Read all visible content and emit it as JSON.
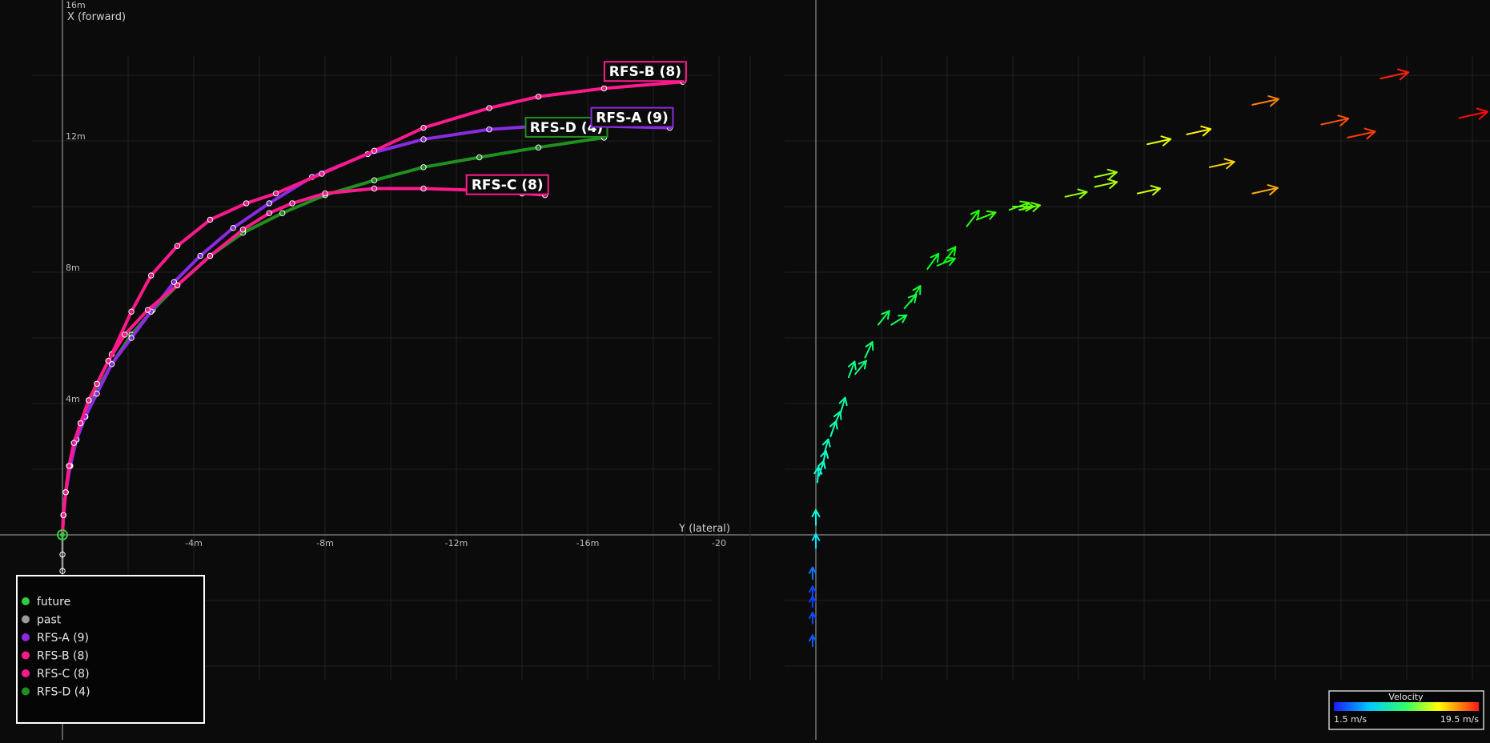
{
  "chart_data": [
    {
      "type": "line",
      "title": "",
      "xlabel": "Y (lateral)",
      "ylabel": "X (forward)",
      "x_ticks": [
        {
          "v": -4,
          "label": "-4m"
        },
        {
          "v": -8,
          "label": "-8m"
        },
        {
          "v": -12,
          "label": "-12m"
        },
        {
          "v": -16,
          "label": "-16m"
        },
        {
          "v": -20,
          "label": "-20"
        }
      ],
      "y_ticks": [
        {
          "v": 4,
          "label": "4m"
        },
        {
          "v": 8,
          "label": "8m"
        },
        {
          "v": 12,
          "label": "12m"
        },
        {
          "v": 16,
          "label": "16m"
        }
      ],
      "xlim": [
        0,
        -20.5
      ],
      "ylim": [
        0,
        16
      ],
      "grid": true,
      "legend_position": "bottom-left",
      "legend": [
        {
          "label": "future",
          "color": "#2ecc40"
        },
        {
          "label": "past",
          "color": "#9a9a9a"
        },
        {
          "label": "RFS-A (9)",
          "color": "#8a2be2"
        },
        {
          "label": "RFS-B (8)",
          "color": "#ff1a8c"
        },
        {
          "label": "RFS-C (8)",
          "color": "#ff1a8c"
        },
        {
          "label": "RFS-D (4)",
          "color": "#1f8f1f"
        }
      ],
      "series": [
        {
          "name": "past",
          "color": "#9a9a9a",
          "points": [
            [
              0,
              0
            ],
            [
              0,
              -0.6
            ],
            [
              0,
              -1.1
            ]
          ]
        },
        {
          "name": "RFS-D (4)",
          "color": "#1f8f1f",
          "label": "RFS-D (4)",
          "points": [
            [
              0,
              0
            ],
            [
              -0.03,
              0.6
            ],
            [
              -0.1,
              1.3
            ],
            [
              -0.23,
              2.1
            ],
            [
              -0.42,
              2.9
            ],
            [
              -0.68,
              3.6
            ],
            [
              -1.0,
              4.3
            ],
            [
              -1.5,
              5.2
            ],
            [
              -2.1,
              6.1
            ],
            [
              -2.75,
              6.85
            ],
            [
              -3.5,
              7.6
            ],
            [
              -4.5,
              8.5
            ],
            [
              -5.5,
              9.2
            ],
            [
              -6.7,
              9.8
            ],
            [
              -8.0,
              10.35
            ],
            [
              -9.5,
              10.8
            ],
            [
              -11.0,
              11.2
            ],
            [
              -12.7,
              11.5
            ],
            [
              -14.5,
              11.8
            ],
            [
              -16.5,
              12.1
            ]
          ]
        },
        {
          "name": "RFS-A (9)",
          "color": "#8a2be2",
          "label": "RFS-A (9)",
          "points": [
            [
              0,
              0
            ],
            [
              -0.03,
              0.6
            ],
            [
              -0.1,
              1.3
            ],
            [
              -0.24,
              2.1
            ],
            [
              -0.43,
              2.9
            ],
            [
              -0.7,
              3.6
            ],
            [
              -1.05,
              4.3
            ],
            [
              -1.5,
              5.2
            ],
            [
              -2.1,
              6.0
            ],
            [
              -2.7,
              6.8
            ],
            [
              -3.4,
              7.7
            ],
            [
              -4.2,
              8.5
            ],
            [
              -5.2,
              9.35
            ],
            [
              -6.3,
              10.1
            ],
            [
              -7.6,
              10.9
            ],
            [
              -9.3,
              11.6
            ],
            [
              -11.0,
              12.05
            ],
            [
              -13.0,
              12.35
            ],
            [
              -14.5,
              12.45
            ],
            [
              -16.5,
              12.45
            ],
            [
              -18.5,
              12.4
            ]
          ]
        },
        {
          "name": "RFS-B (8)",
          "color": "#ff1a8c",
          "label": "RFS-B (8)",
          "points": [
            [
              0,
              0
            ],
            [
              -0.03,
              0.6
            ],
            [
              -0.1,
              1.3
            ],
            [
              -0.2,
              2.1
            ],
            [
              -0.35,
              2.8
            ],
            [
              -0.55,
              3.4
            ],
            [
              -0.8,
              4.1
            ],
            [
              -1.05,
              4.6
            ],
            [
              -1.4,
              5.3
            ],
            [
              -1.5,
              5.5
            ],
            [
              -2.1,
              6.8
            ],
            [
              -2.7,
              7.9
            ],
            [
              -3.5,
              8.8
            ],
            [
              -4.5,
              9.6
            ],
            [
              -5.6,
              10.1
            ],
            [
              -6.5,
              10.4
            ],
            [
              -7.9,
              11.0
            ],
            [
              -9.5,
              11.7
            ],
            [
              -11.0,
              12.4
            ],
            [
              -13.0,
              13.0
            ],
            [
              -14.5,
              13.35
            ],
            [
              -16.5,
              13.6
            ],
            [
              -18.9,
              13.8
            ]
          ]
        },
        {
          "name": "RFS-C (8)",
          "color": "#ff1a8c",
          "label": "RFS-C (8)",
          "points": [
            [
              0,
              0
            ],
            [
              -0.03,
              0.6
            ],
            [
              -0.1,
              1.3
            ],
            [
              -0.2,
              2.1
            ],
            [
              -0.35,
              2.8
            ],
            [
              -0.55,
              3.4
            ],
            [
              -0.8,
              4.1
            ],
            [
              -1.05,
              4.6
            ],
            [
              -1.4,
              5.3
            ],
            [
              -1.9,
              6.1
            ],
            [
              -2.6,
              6.85
            ],
            [
              -3.5,
              7.6
            ],
            [
              -4.5,
              8.5
            ],
            [
              -5.5,
              9.3
            ],
            [
              -6.3,
              9.8
            ],
            [
              -7.0,
              10.1
            ],
            [
              -8.0,
              10.4
            ],
            [
              -9.5,
              10.55
            ],
            [
              -11.0,
              10.55
            ],
            [
              -12.5,
              10.5
            ],
            [
              -14.0,
              10.4
            ],
            [
              -14.7,
              10.35
            ]
          ]
        }
      ]
    },
    {
      "type": "scatter",
      "title": "",
      "colorbar": {
        "title": "Velocity",
        "min_label": "1.5 m/s",
        "max_label": "19.5 m/s",
        "min": 1.5,
        "max": 19.5
      },
      "vectors": [
        {
          "x": -0.1,
          "y": -3.4,
          "v": 3.0
        },
        {
          "x": -0.1,
          "y": -2.7,
          "v": 2.7
        },
        {
          "x": -0.1,
          "y": -2.2,
          "v": 2.5
        },
        {
          "x": -0.1,
          "y": -1.9,
          "v": 2.6
        },
        {
          "x": -0.1,
          "y": -1.35,
          "v": 3.5
        },
        {
          "x": 0.0,
          "y": -0.4,
          "v": 5.5
        },
        {
          "x": 0.0,
          "y": 0.3,
          "v": 6.5
        },
        {
          "x": 0.05,
          "y": 1.6,
          "v": 6.8
        },
        {
          "x": 0.1,
          "y": 1.8,
          "v": 6.9
        },
        {
          "x": 0.2,
          "y": 2.1,
          "v": 7.0
        },
        {
          "x": 0.25,
          "y": 2.45,
          "v": 7.2
        },
        {
          "x": 0.45,
          "y": 3.0,
          "v": 7.4
        },
        {
          "x": 0.55,
          "y": 3.3,
          "v": 7.6
        },
        {
          "x": 0.75,
          "y": 3.7,
          "v": 7.8
        },
        {
          "x": 1.0,
          "y": 4.8,
          "v": 8.2
        },
        {
          "x": 1.2,
          "y": 4.9,
          "v": 8.4
        },
        {
          "x": 1.5,
          "y": 5.4,
          "v": 8.6
        },
        {
          "x": 1.9,
          "y": 6.4,
          "v": 9.0
        },
        {
          "x": 2.3,
          "y": 6.4,
          "v": 9.2
        },
        {
          "x": 2.7,
          "y": 6.9,
          "v": 9.4
        },
        {
          "x": 2.9,
          "y": 7.1,
          "v": 9.6
        },
        {
          "x": 3.4,
          "y": 8.1,
          "v": 10.0
        },
        {
          "x": 3.7,
          "y": 8.2,
          "v": 10.3
        },
        {
          "x": 3.9,
          "y": 8.3,
          "v": 10.5
        },
        {
          "x": 4.6,
          "y": 9.4,
          "v": 11.0
        },
        {
          "x": 4.9,
          "y": 9.6,
          "v": 11.3
        },
        {
          "x": 5.9,
          "y": 9.9,
          "v": 11.8
        },
        {
          "x": 6.0,
          "y": 10.0,
          "v": 12.0
        },
        {
          "x": 6.2,
          "y": 9.9,
          "v": 12.2
        },
        {
          "x": 7.6,
          "y": 10.3,
          "v": 13.0
        },
        {
          "x": 8.5,
          "y": 10.6,
          "v": 13.5
        },
        {
          "x": 9.8,
          "y": 10.4,
          "v": 14.0
        },
        {
          "x": 8.5,
          "y": 10.9,
          "v": 13.3
        },
        {
          "x": 10.1,
          "y": 11.9,
          "v": 14.6
        },
        {
          "x": 11.3,
          "y": 12.2,
          "v": 15.2
        },
        {
          "x": 12.0,
          "y": 11.2,
          "v": 15.8
        },
        {
          "x": 13.3,
          "y": 10.4,
          "v": 16.5
        },
        {
          "x": 13.3,
          "y": 13.1,
          "v": 17.3
        },
        {
          "x": 15.4,
          "y": 12.5,
          "v": 18.2
        },
        {
          "x": 16.2,
          "y": 12.1,
          "v": 18.6
        },
        {
          "x": 17.2,
          "y": 13.9,
          "v": 19.1
        },
        {
          "x": 19.6,
          "y": 12.7,
          "v": 19.5
        }
      ]
    }
  ]
}
